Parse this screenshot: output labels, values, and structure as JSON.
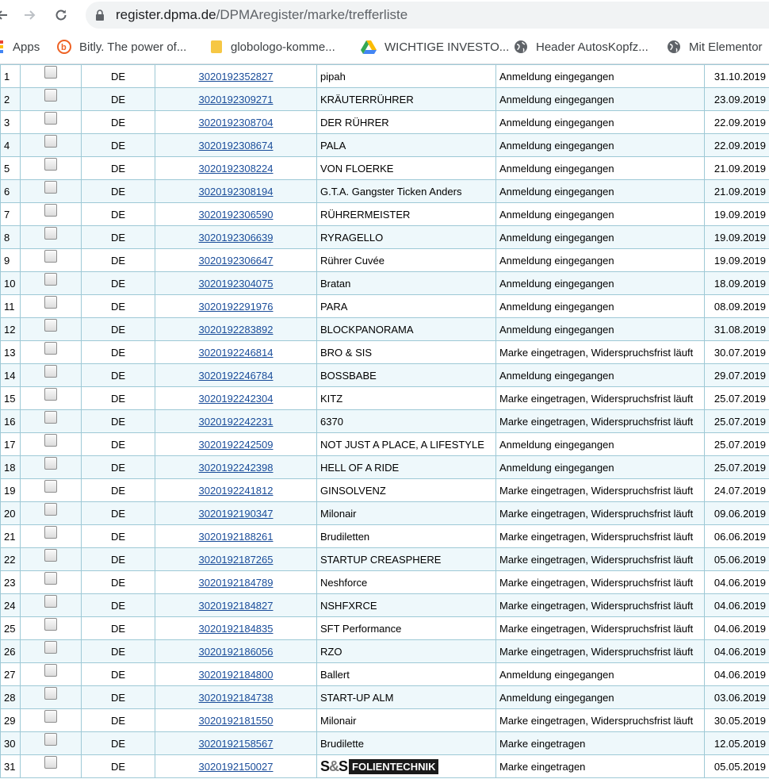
{
  "browser": {
    "url_host": "register.dpma.de",
    "url_path": "/DPMAregister/marke/trefferliste",
    "nav": {
      "back": "arrow-left-icon",
      "forward": "arrow-right-icon",
      "reload": "reload-icon"
    }
  },
  "bookmarks": [
    {
      "label": "Apps",
      "icon": "apps-grid-icon"
    },
    {
      "label": "Bitly. The power of...",
      "icon": "bitly-icon"
    },
    {
      "label": "globologo-komme...",
      "icon": "folder-doc-icon"
    },
    {
      "label": "WICHTIGE INVESTO...",
      "icon": "google-drive-icon"
    },
    {
      "label": "Header AutosKopfz...",
      "icon": "globe-icon"
    },
    {
      "label": "Mit Elementor",
      "icon": "globe-icon"
    }
  ],
  "colors": {
    "link": "#1a4d9a",
    "row_alt": "#eef8fb",
    "grid": "#9ec9d6"
  },
  "rows": [
    {
      "n": "1",
      "country": "DE",
      "aktz": "3020192352827",
      "marke": "pipah",
      "status": "Anmeldung eingegangen",
      "date": "31.10.2019"
    },
    {
      "n": "2",
      "country": "DE",
      "aktz": "3020192309271",
      "marke": "KRÄUTERRÜHRER",
      "status": "Anmeldung eingegangen",
      "date": "23.09.2019"
    },
    {
      "n": "3",
      "country": "DE",
      "aktz": "3020192308704",
      "marke": "DER RÜHRER",
      "status": "Anmeldung eingegangen",
      "date": "22.09.2019"
    },
    {
      "n": "4",
      "country": "DE",
      "aktz": "3020192308674",
      "marke": "PALA",
      "status": "Anmeldung eingegangen",
      "date": "22.09.2019"
    },
    {
      "n": "5",
      "country": "DE",
      "aktz": "3020192308224",
      "marke": "VON FLOERKE",
      "status": "Anmeldung eingegangen",
      "date": "21.09.2019"
    },
    {
      "n": "6",
      "country": "DE",
      "aktz": "3020192308194",
      "marke": "G.T.A. Gangster Ticken Anders",
      "status": "Anmeldung eingegangen",
      "date": "21.09.2019"
    },
    {
      "n": "7",
      "country": "DE",
      "aktz": "3020192306590",
      "marke": "RÜHRERMEISTER",
      "status": "Anmeldung eingegangen",
      "date": "19.09.2019"
    },
    {
      "n": "8",
      "country": "DE",
      "aktz": "3020192306639",
      "marke": "RYRAGELLO",
      "status": "Anmeldung eingegangen",
      "date": "19.09.2019"
    },
    {
      "n": "9",
      "country": "DE",
      "aktz": "3020192306647",
      "marke": "Rührer Cuvée",
      "status": "Anmeldung eingegangen",
      "date": "19.09.2019"
    },
    {
      "n": "10",
      "country": "DE",
      "aktz": "3020192304075",
      "marke": "Bratan",
      "status": "Anmeldung eingegangen",
      "date": "18.09.2019"
    },
    {
      "n": "11",
      "country": "DE",
      "aktz": "3020192291976",
      "marke": "PARA",
      "status": "Anmeldung eingegangen",
      "date": "08.09.2019"
    },
    {
      "n": "12",
      "country": "DE",
      "aktz": "3020192283892",
      "marke": "BLOCKPANORAMA",
      "status": "Anmeldung eingegangen",
      "date": "31.08.2019"
    },
    {
      "n": "13",
      "country": "DE",
      "aktz": "3020192246814",
      "marke": "BRO & SIS",
      "status": "Marke eingetragen, Widerspruchsfrist läuft",
      "date": "30.07.2019"
    },
    {
      "n": "14",
      "country": "DE",
      "aktz": "3020192246784",
      "marke": "BOSSBABE",
      "status": "Anmeldung eingegangen",
      "date": "29.07.2019"
    },
    {
      "n": "15",
      "country": "DE",
      "aktz": "3020192242304",
      "marke": "KITZ",
      "status": "Marke eingetragen, Widerspruchsfrist läuft",
      "date": "25.07.2019"
    },
    {
      "n": "16",
      "country": "DE",
      "aktz": "3020192242231",
      "marke": "6370",
      "status": "Marke eingetragen, Widerspruchsfrist läuft",
      "date": "25.07.2019"
    },
    {
      "n": "17",
      "country": "DE",
      "aktz": "3020192242509",
      "marke": "NOT JUST A PLACE, A LIFESTYLE",
      "status": "Anmeldung eingegangen",
      "date": "25.07.2019"
    },
    {
      "n": "18",
      "country": "DE",
      "aktz": "3020192242398",
      "marke": "HELL OF A RIDE",
      "status": "Anmeldung eingegangen",
      "date": "25.07.2019"
    },
    {
      "n": "19",
      "country": "DE",
      "aktz": "3020192241812",
      "marke": "GINSOLVENZ",
      "status": "Marke eingetragen, Widerspruchsfrist läuft",
      "date": "24.07.2019"
    },
    {
      "n": "20",
      "country": "DE",
      "aktz": "3020192190347",
      "marke": "Milonair",
      "status": "Marke eingetragen, Widerspruchsfrist läuft",
      "date": "09.06.2019"
    },
    {
      "n": "21",
      "country": "DE",
      "aktz": "3020192188261",
      "marke": "Brudiletten",
      "status": "Marke eingetragen, Widerspruchsfrist läuft",
      "date": "06.06.2019"
    },
    {
      "n": "22",
      "country": "DE",
      "aktz": "3020192187265",
      "marke": "STARTUP CREASPHERE",
      "status": "Marke eingetragen, Widerspruchsfrist läuft",
      "date": "05.06.2019"
    },
    {
      "n": "23",
      "country": "DE",
      "aktz": "3020192184789",
      "marke": "Neshforce",
      "status": "Marke eingetragen, Widerspruchsfrist läuft",
      "date": "04.06.2019"
    },
    {
      "n": "24",
      "country": "DE",
      "aktz": "3020192184827",
      "marke": "NSHFXRCE",
      "status": "Marke eingetragen, Widerspruchsfrist läuft",
      "date": "04.06.2019"
    },
    {
      "n": "25",
      "country": "DE",
      "aktz": "3020192184835",
      "marke": "SFT Performance",
      "status": "Marke eingetragen, Widerspruchsfrist läuft",
      "date": "04.06.2019"
    },
    {
      "n": "26",
      "country": "DE",
      "aktz": "3020192186056",
      "marke": "RZO",
      "status": "Marke eingetragen, Widerspruchsfrist läuft",
      "date": "04.06.2019"
    },
    {
      "n": "27",
      "country": "DE",
      "aktz": "3020192184800",
      "marke": "Ballert",
      "status": "Anmeldung eingegangen",
      "date": "04.06.2019"
    },
    {
      "n": "28",
      "country": "DE",
      "aktz": "3020192184738",
      "marke": "START-UP ALM",
      "status": "Anmeldung eingegangen",
      "date": "03.06.2019"
    },
    {
      "n": "29",
      "country": "DE",
      "aktz": "3020192181550",
      "marke": "Milonair",
      "status": "Marke eingetragen, Widerspruchsfrist läuft",
      "date": "30.05.2019"
    },
    {
      "n": "30",
      "country": "DE",
      "aktz": "3020192158567",
      "marke": "Brudilette",
      "status": "Marke eingetragen",
      "date": "12.05.2019"
    },
    {
      "n": "31",
      "country": "DE",
      "aktz": "3020192150027",
      "marke": "",
      "logo": "S&S FOLIENTECHNIK",
      "status": "Marke eingetragen",
      "date": "05.05.2019"
    }
  ]
}
